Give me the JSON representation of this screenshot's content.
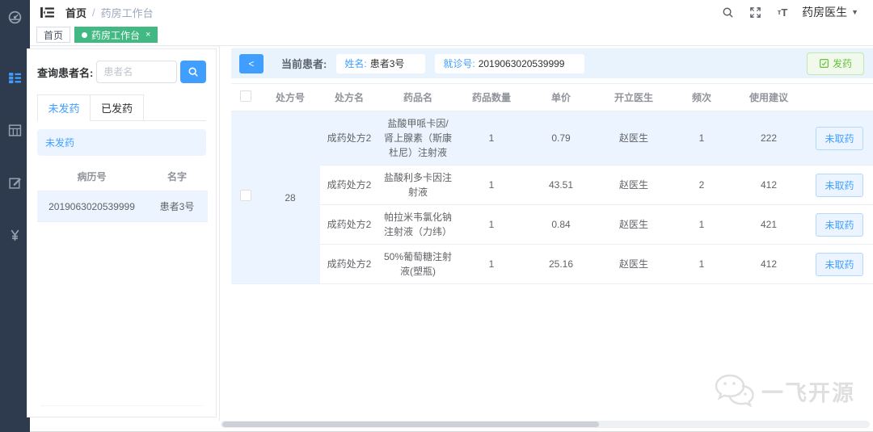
{
  "colors": {
    "accent": "#409eff",
    "success_tag": "#42b983",
    "sidebar_bg": "#2e3a4e",
    "highlight_row": "#ecf5ff",
    "dispense_green": "#67c23a"
  },
  "navbar": {
    "breadcrumb": {
      "home": "首页",
      "separator": "/",
      "current": "药房工作台"
    },
    "user": {
      "name": "药房医生",
      "caret": "▼"
    }
  },
  "tags": {
    "home": "首页",
    "active": {
      "label": "药房工作台",
      "close": "×"
    }
  },
  "patient_panel": {
    "search_label": "查询患者名:",
    "search_placeholder": "患者名",
    "tabs": [
      {
        "label": "未发药"
      },
      {
        "label": "已发药"
      }
    ],
    "alert": "未发药",
    "table": {
      "headers": [
        "病历号",
        "名字"
      ],
      "rows": [
        {
          "record_no": "2019063020539999",
          "name": "患者3号"
        }
      ]
    }
  },
  "toolbar": {
    "back": "<",
    "current_patient_label": "当前患者:",
    "name_label": "姓名:",
    "name_value": "患者3号",
    "visit_label": "就诊号:",
    "visit_value": "2019063020539999",
    "dispense_label": "发药"
  },
  "prescription_table": {
    "headers": [
      "处方号",
      "处方名",
      "药品名",
      "药品数量",
      "单价",
      "开立医生",
      "频次",
      "使用建议"
    ],
    "prescription_no": "28",
    "rows": [
      {
        "rx_name": "成药处方2",
        "drug": "盐酸甲哌卡因/肾上腺素（斯康杜尼）注射液",
        "qty": "1",
        "price": "0.79",
        "doctor": "赵医生",
        "freq": "1",
        "advice": "222",
        "action": "未取药"
      },
      {
        "rx_name": "成药处方2",
        "drug": "盐酸利多卡因注射液",
        "qty": "1",
        "price": "43.51",
        "doctor": "赵医生",
        "freq": "2",
        "advice": "412",
        "action": "未取药"
      },
      {
        "rx_name": "成药处方2",
        "drug": "帕拉米韦氯化钠注射液（力纬）",
        "qty": "1",
        "price": "0.84",
        "doctor": "赵医生",
        "freq": "1",
        "advice": "421",
        "action": "未取药"
      },
      {
        "rx_name": "成药处方2",
        "drug": "50%葡萄糖注射液(塑瓶)",
        "qty": "1",
        "price": "25.16",
        "doctor": "赵医生",
        "freq": "1",
        "advice": "412",
        "action": "未取药"
      }
    ]
  },
  "watermark": {
    "text": "一飞开源"
  }
}
